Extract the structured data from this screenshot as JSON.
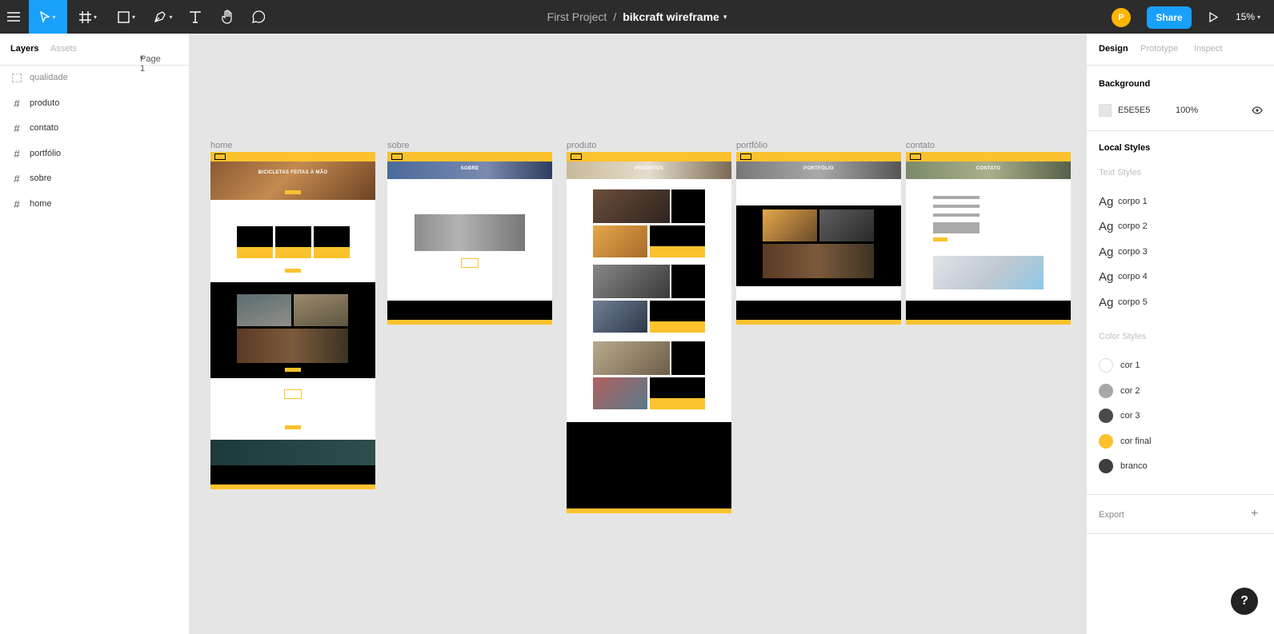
{
  "toolbar": {
    "project": "First Project",
    "separator": "/",
    "file_name": "bikcraft wireframe",
    "avatar_letter": "P",
    "share_label": "Share",
    "zoom": "15%"
  },
  "left_panel": {
    "tabs": [
      "Layers",
      "Assets"
    ],
    "page_selector": "Page 1",
    "layers": [
      {
        "name": "qualidade",
        "icon": "group-icon"
      },
      {
        "name": "produto",
        "icon": "frame-icon"
      },
      {
        "name": "contato",
        "icon": "frame-icon"
      },
      {
        "name": "portfólio",
        "icon": "frame-icon"
      },
      {
        "name": "sobre",
        "icon": "frame-icon"
      },
      {
        "name": "home",
        "icon": "frame-icon"
      }
    ]
  },
  "right_panel": {
    "tabs": [
      "Design",
      "Prototype",
      "Inspect"
    ],
    "background_title": "Background",
    "background_hex": "E5E5E5",
    "background_opacity": "100%",
    "local_styles_title": "Local Styles",
    "text_styles_title": "Text Styles",
    "text_styles": [
      "corpo 1",
      "corpo 2",
      "corpo 3",
      "corpo 4",
      "corpo 5"
    ],
    "text_style_glyph": "Ag",
    "color_styles_title": "Color Styles",
    "color_styles": [
      {
        "name": "cor 1",
        "color": "#ffffff"
      },
      {
        "name": "cor 2",
        "color": "#a8a8a8"
      },
      {
        "name": "cor 3",
        "color": "#4a4a4a"
      },
      {
        "name": "cor final",
        "color": "#fcc22d"
      },
      {
        "name": "branco",
        "color": "#3d3d3d"
      }
    ],
    "export_title": "Export"
  },
  "canvas": {
    "frames": [
      {
        "label": "home",
        "hero_text": "BICICLETAS FEITAS À MÃO"
      },
      {
        "label": "sobre",
        "hero_text": "SOBRE"
      },
      {
        "label": "produto",
        "hero_text": "PRODUTOS"
      },
      {
        "label": "portfólio",
        "hero_text": "PORTFÓLIO"
      },
      {
        "label": "contato",
        "hero_text": "CONTATO"
      }
    ]
  },
  "colors": {
    "accent": "#18a0fb",
    "toolbar_bg": "#2c2c2c",
    "brand_yellow": "#fcc22d"
  }
}
